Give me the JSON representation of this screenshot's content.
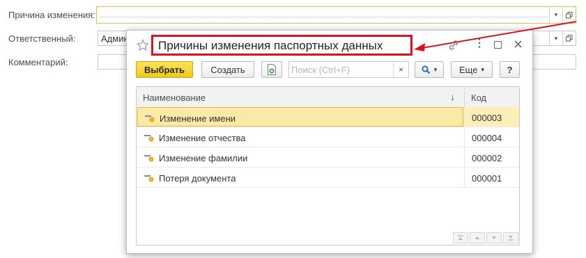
{
  "form": {
    "reason_label": "Причина изменения:",
    "responsible_label": "Ответственный:",
    "responsible_value": "Админ",
    "comment_label": "Комментарий:",
    "comment_value": ""
  },
  "dialog": {
    "title": "Причины изменения паспортных данных",
    "select_button": "Выбрать",
    "create_button": "Создать",
    "search_placeholder": "Поиск (Ctrl+F)",
    "more_button": "Еще",
    "help_button": "?",
    "columns": {
      "name": "Наименование",
      "code": "Код",
      "sort_indicator": "↓"
    },
    "rows": [
      {
        "name": "Изменение имени",
        "code": "000003",
        "selected": true
      },
      {
        "name": "Изменение отчества",
        "code": "000004",
        "selected": false
      },
      {
        "name": "Изменение фамилии",
        "code": "000002",
        "selected": false
      },
      {
        "name": "Потеря документа",
        "code": "000001",
        "selected": false
      }
    ]
  },
  "colors": {
    "accent_yellow": "#f1c818",
    "annotation_red": "#e0101b",
    "selected_row": "#fbeeb8"
  }
}
